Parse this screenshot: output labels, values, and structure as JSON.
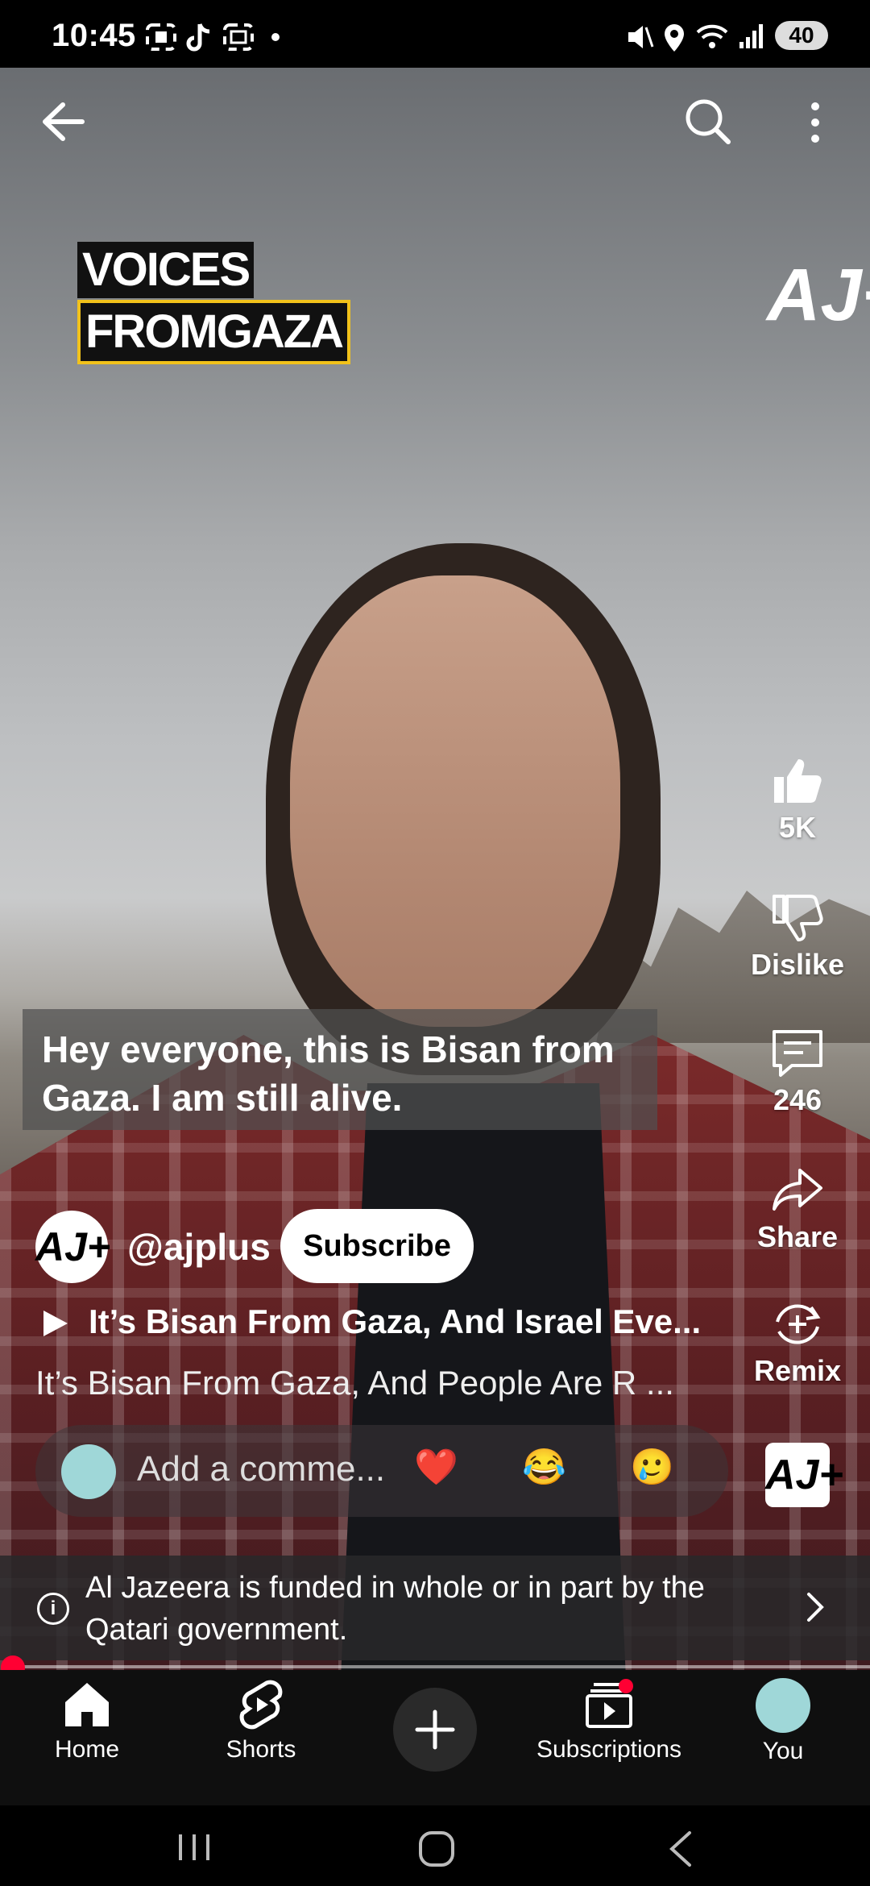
{
  "status_bar": {
    "time": "10:45",
    "battery": "40"
  },
  "video": {
    "overlay_logo_lines": [
      "VOICES",
      "FROMGAZA"
    ],
    "watermark": "AJ+",
    "caption": "Hey everyone, this is Bisan from Gaza. I am still alive."
  },
  "actions": {
    "like_count": "5K",
    "dislike_label": "Dislike",
    "comment_count": "246",
    "share_label": "Share",
    "remix_label": "Remix"
  },
  "channel": {
    "avatar_text": "AJ+",
    "handle": "@ajplus",
    "subscribe_label": "Subscribe"
  },
  "related_title": "It’s Bisan From Gaza, And Israel Eve...",
  "description": "It’s Bisan From Gaza, And People Are R ...",
  "comment_bar": {
    "placeholder": "Add a comme...",
    "emojis": [
      "❤️",
      "😂",
      "🥲"
    ]
  },
  "info_banner": {
    "text": "Al Jazeera is funded in whole or in part by the Qatari government."
  },
  "progress_fraction": 0.0,
  "bottom_nav": {
    "home": "Home",
    "shorts": "Shorts",
    "subscriptions": "Subscriptions",
    "you": "You"
  },
  "colors": {
    "accent": "#ff0033",
    "logo_yellow": "#f2c21b"
  }
}
